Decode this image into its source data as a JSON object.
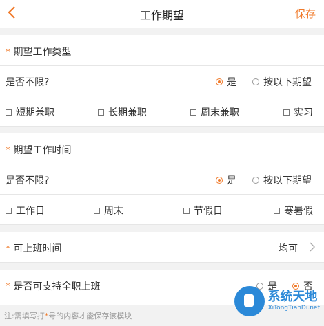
{
  "header": {
    "title": "工作期望",
    "save_label": "保存"
  },
  "job_type": {
    "heading": "期望工作类型",
    "question": "是否不限?",
    "option_yes": "是",
    "option_custom": "按以下期望",
    "selected": "是",
    "checkboxes": [
      "短期兼职",
      "长期兼职",
      "周末兼职",
      "实习"
    ]
  },
  "work_time": {
    "heading": "期望工作时间",
    "question": "是否不限?",
    "option_yes": "是",
    "option_custom": "按以下期望",
    "selected": "是",
    "checkboxes": [
      "工作日",
      "周末",
      "节假日",
      "寒暑假"
    ]
  },
  "available": {
    "label": "可上班时间",
    "value": "均可"
  },
  "fulltime": {
    "label": "是否可支持全职上班",
    "option_yes": "是",
    "option_no": "否",
    "selected": "否"
  },
  "footer": {
    "note_prefix": "注:需填写打",
    "note_star": "*",
    "note_suffix": "号的内容才能保存该模块"
  },
  "watermark": {
    "title": "系统天地",
    "subtitle": "XiTongTianDi.net"
  },
  "colors": {
    "accent": "#f07a2a",
    "watermark": "#2b89d8"
  }
}
